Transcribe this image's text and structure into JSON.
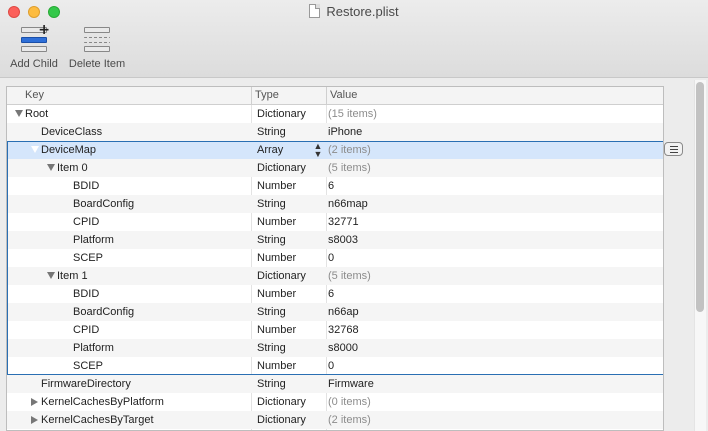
{
  "window": {
    "title": "Restore.plist"
  },
  "toolbar": {
    "add_child_label": "Add Child",
    "delete_item_label": "Delete Item"
  },
  "columns": {
    "key": "Key",
    "type": "Type",
    "value": "Value"
  },
  "colors": {
    "selection": "#d5e6fb",
    "accent": "#2e6fd8"
  },
  "rows": [
    {
      "key": "Root",
      "type": "Dictionary",
      "value": "(15 items)",
      "expander": "down"
    },
    {
      "key": "DeviceClass",
      "type": "String",
      "value": "iPhone"
    },
    {
      "key": "DeviceMap",
      "type": "Array",
      "value": "(2 items)",
      "expander": "down",
      "selected": true
    },
    {
      "key": "Item 0",
      "type": "Dictionary",
      "value": "(5 items)",
      "expander": "down"
    },
    {
      "key": "BDID",
      "type": "Number",
      "value": "6"
    },
    {
      "key": "BoardConfig",
      "type": "String",
      "value": "n66map"
    },
    {
      "key": "CPID",
      "type": "Number",
      "value": "32771"
    },
    {
      "key": "Platform",
      "type": "String",
      "value": "s8003"
    },
    {
      "key": "SCEP",
      "type": "Number",
      "value": "0"
    },
    {
      "key": "Item 1",
      "type": "Dictionary",
      "value": "(5 items)",
      "expander": "down"
    },
    {
      "key": "BDID",
      "type": "Number",
      "value": "6"
    },
    {
      "key": "BoardConfig",
      "type": "String",
      "value": "n66ap"
    },
    {
      "key": "CPID",
      "type": "Number",
      "value": "32768"
    },
    {
      "key": "Platform",
      "type": "String",
      "value": "s8000"
    },
    {
      "key": "SCEP",
      "type": "Number",
      "value": "0"
    },
    {
      "key": "FirmwareDirectory",
      "type": "String",
      "value": "Firmware"
    },
    {
      "key": "KernelCachesByPlatform",
      "type": "Dictionary",
      "value": "(0 items)",
      "expander": "right"
    },
    {
      "key": "KernelCachesByTarget",
      "type": "Dictionary",
      "value": "(2 items)",
      "expander": "right"
    }
  ]
}
